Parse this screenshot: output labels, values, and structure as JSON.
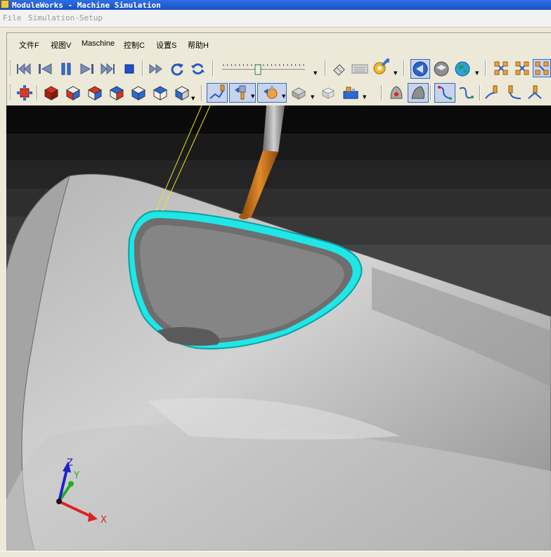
{
  "window": {
    "title": "ModuleWorks - Machine Simulation"
  },
  "top_menu": [
    "File",
    "Simulation-Setup"
  ],
  "menu": [
    "文件F",
    "视图V",
    "Maschine",
    "控制C",
    "设置S",
    "帮助H"
  ],
  "toolbar_row1": {
    "playback": [
      "skip-to-start-icon",
      "step-back-icon",
      "pause-icon",
      "step-forward-icon",
      "fast-forward-icon",
      "stop-icon"
    ],
    "extra": [
      "double-play-icon",
      "reload-icon",
      "refresh-icon"
    ],
    "speed_slider": {
      "label": "speed-slider",
      "value": 0.42
    },
    "display": [
      "eraser-icon",
      "keyboard-icon",
      "settings-icon",
      "view-blue-icon",
      "view-gray-icon",
      "globe-icon",
      "axes-multi-icon-1",
      "axes-multi-icon-2",
      "axes-multi-icon-3"
    ]
  },
  "toolbar_row2": {
    "views": [
      "origin-view-icon",
      "cube-red-icon",
      "cube-front-icon",
      "cube-right-icon",
      "cube-top-icon",
      "cube-left-icon",
      "cube-back-icon",
      "cube-iso-icon"
    ],
    "tools": [
      "tool-path-icon",
      "tool-holder-icon",
      "tool-ball-icon",
      "workpiece-icon",
      "stock-icon",
      "fixture-icon",
      "collision-icon",
      "material-icon",
      "path-line-icon",
      "path-curve-icon",
      "tool-axis-icon-1",
      "tool-axis-icon-2",
      "tool-axis-icon-3"
    ]
  },
  "viewport": {
    "axes": {
      "x": "X",
      "y": "Y",
      "z": "Z"
    },
    "colors": {
      "background": "#202020",
      "toolpath": "#20e6e6",
      "tool_holder": "#c86a14",
      "axis_x": "#e02020",
      "axis_y": "#20b020",
      "axis_z": "#2020d0"
    }
  }
}
